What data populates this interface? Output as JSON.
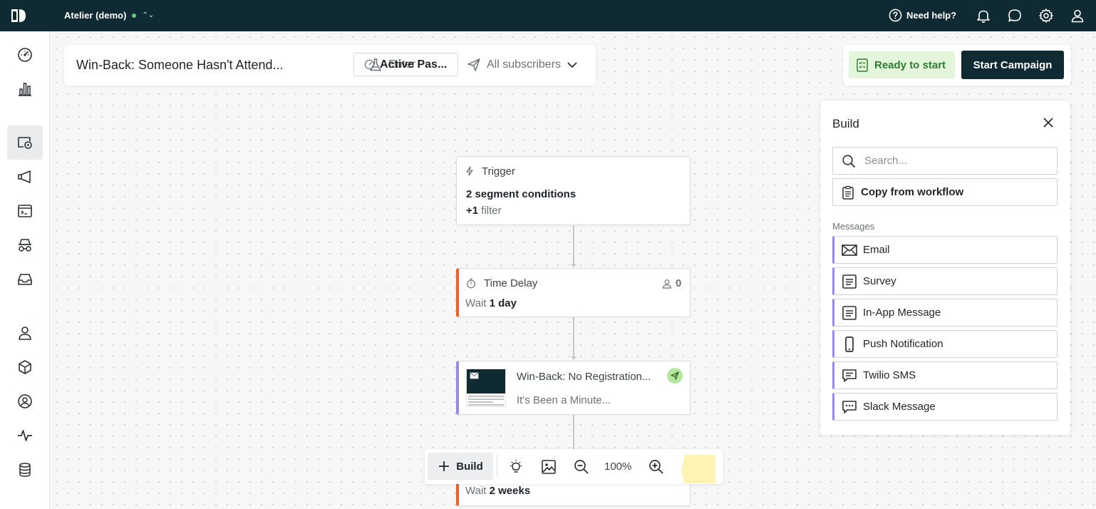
{
  "topbar": {
    "workspace_name": "Atelier (demo)",
    "workspace_caret": "⌃⌄",
    "help_label": "Need help?",
    "status_color": "#5ad07a",
    "bg_color": "#0f2a33"
  },
  "sidebar": {
    "items": [
      {
        "icon": "dashboard-icon"
      },
      {
        "icon": "analytics-icon"
      },
      {
        "icon": "campaigns-icon",
        "active": true
      },
      {
        "icon": "broadcasts-icon"
      },
      {
        "icon": "transactional-icon"
      },
      {
        "icon": "segments-icon"
      },
      {
        "icon": "inbox-icon"
      },
      {
        "icon": "people-icon"
      },
      {
        "icon": "objects-icon"
      },
      {
        "icon": "accounts-icon"
      },
      {
        "icon": "activity-icon"
      },
      {
        "icon": "data-icon"
      }
    ]
  },
  "workflow": {
    "title": "Win-Back: Someone Hasn't Attend...",
    "mode_label": "Enter",
    "status_label": "Active Pas...",
    "audience_label": "All subscribers"
  },
  "actions": {
    "ready_label": "Ready to start",
    "start_label": "Start Campaign",
    "ready_color": "#2f7d32"
  },
  "nodes": {
    "trigger": {
      "title": "Trigger",
      "conditions": "2 segment conditions",
      "filter_count": "+1",
      "filter_word": "filter"
    },
    "delay": {
      "title": "Time Delay",
      "people_count": "0",
      "wait_prefix": "Wait",
      "wait_value": "1 day"
    },
    "email": {
      "title": "Win-Back: No Registration...",
      "subject": "It's Been a Minute..."
    },
    "delay2": {
      "wait_prefix": "Wait",
      "wait_value": "2 weeks"
    }
  },
  "toolbar": {
    "build_label": "Build",
    "zoom": "100%"
  },
  "build_panel": {
    "title": "Build",
    "search_placeholder": "Search...",
    "copy_label": "Copy from workflow",
    "section_label": "Messages",
    "messages": [
      {
        "label": "Email",
        "icon": "email-icon"
      },
      {
        "label": "Survey",
        "icon": "survey-icon"
      },
      {
        "label": "In-App Message",
        "icon": "in-app-icon"
      },
      {
        "label": "Push Notification",
        "icon": "phone-icon"
      },
      {
        "label": "Twilio SMS",
        "icon": "sms-icon"
      },
      {
        "label": "Slack Message",
        "icon": "slack-message-icon"
      }
    ],
    "accent_color": "#9b8be0"
  }
}
